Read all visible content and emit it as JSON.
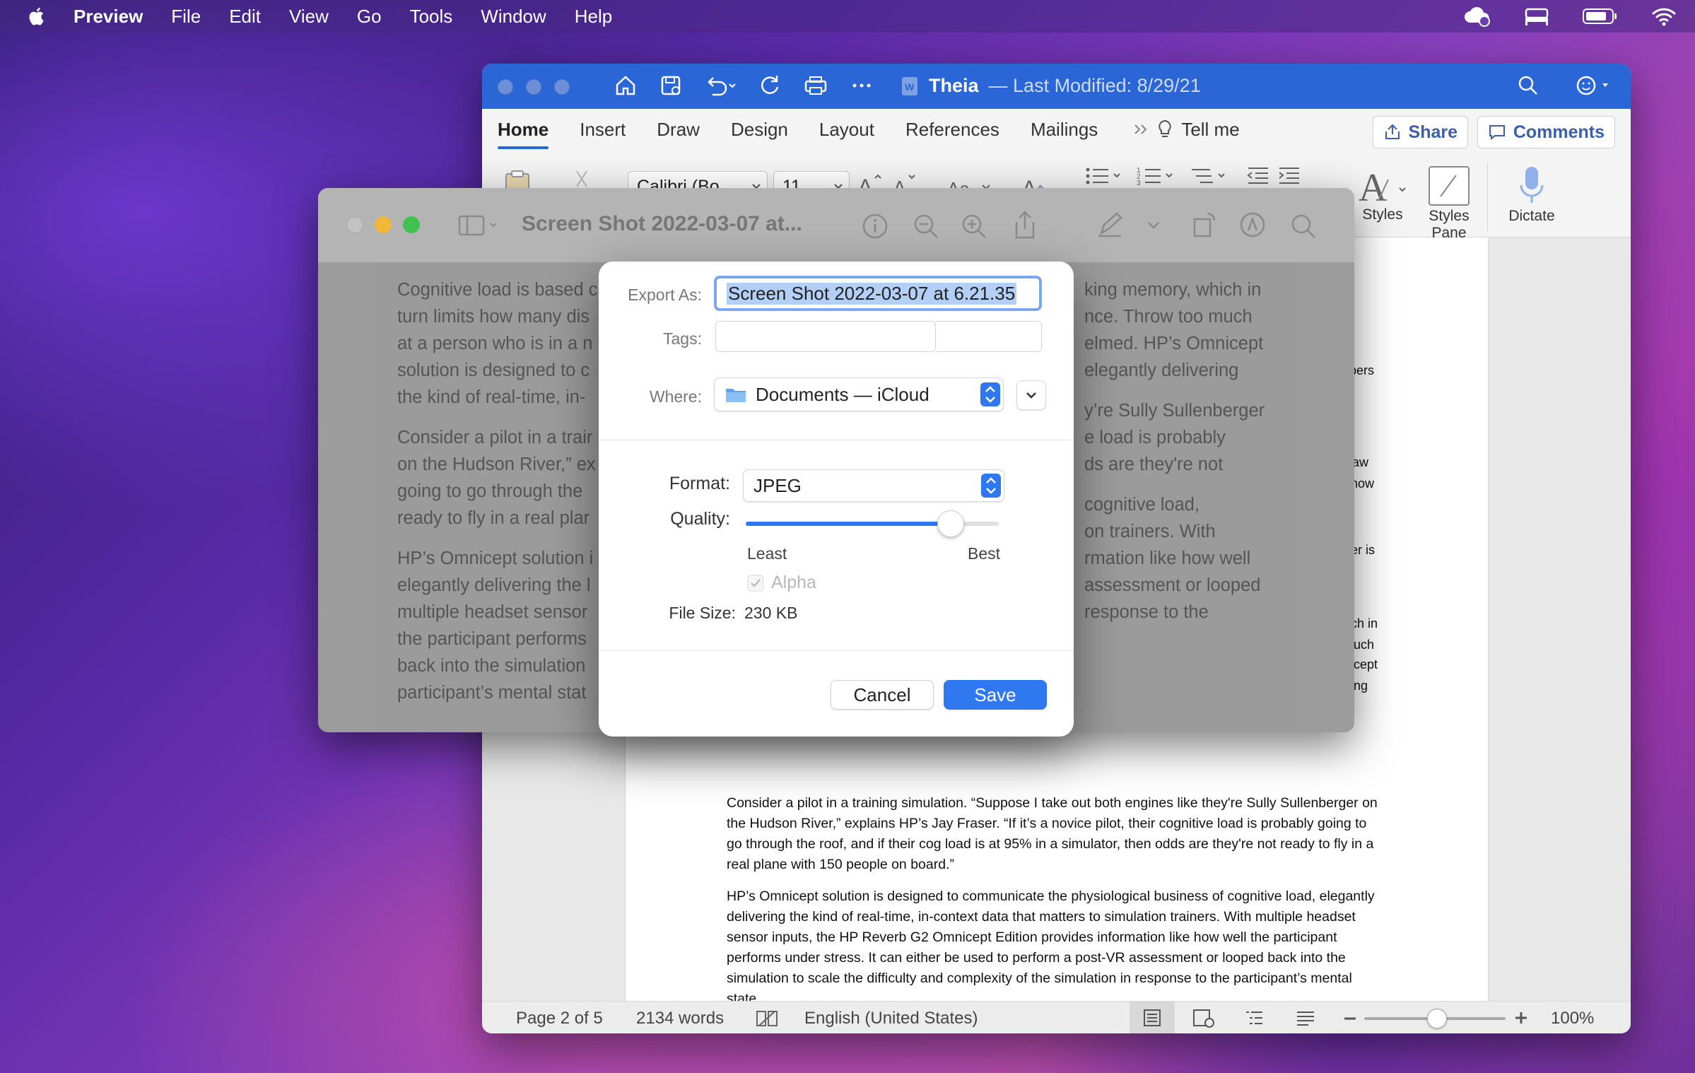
{
  "menubar": {
    "app_name": "Preview",
    "items": [
      "File",
      "Edit",
      "View",
      "Go",
      "Tools",
      "Window",
      "Help"
    ]
  },
  "word": {
    "doc_name": "Theia",
    "modified": "— Last Modified: 8/29/21",
    "tabs": [
      "Home",
      "Insert",
      "Draw",
      "Design",
      "Layout",
      "References",
      "Mailings"
    ],
    "tell_me": "Tell me",
    "share": "Share",
    "comments": "Comments",
    "font_name": "Calibri (Bo...",
    "font_size": "11",
    "styles": "Styles",
    "styles_pane_1": "Styles",
    "styles_pane_2": "Pane",
    "dictate": "Dictate",
    "edge_fragments": [
      "ppers",
      "aw",
      "now",
      "er is",
      "ch in",
      "uch",
      "icept",
      "ng"
    ],
    "para1": "Consider a pilot in a training simulation. “Suppose I take out both engines like they're Sully Sullenberger on the Hudson River,” explains HP’s Jay Fraser. “If it’s a novice pilot, their cognitive load is probably going to go through the roof, and if their cog load is at 95% in a simulator, then odds are they're not ready to fly in a real plane with 150 people on board.”",
    "para2": "HP’s Omnicept solution is designed to communicate the physiological business of cognitive load, elegantly delivering the kind of real-time, in-context data that matters to simulation trainers. With multiple headset sensor inputs, the HP Reverb G2 Omnicept Edition provides information like how well the participant performs under stress. It can either be used to perform a post-VR assessment or looped back into the simulation to scale the difficulty and complexity of the simulation in response to the participant’s mental state.",
    "status": {
      "page": "Page 2 of 5",
      "words": "2134 words",
      "language": "English (United States)",
      "zoom": "100%"
    }
  },
  "preview": {
    "title": "Screen Shot 2022-03-07 at...",
    "left_lines": [
      "Cognitive load is based c",
      "turn limits how many dis",
      "at a person who is in a n",
      "solution is designed to c",
      "the kind of real-time, in-",
      "Consider a pilot in a trair",
      "on the Hudson River,” ex",
      "going to go through the",
      "ready to fly in a real plar",
      "HP’s Omnicept solution i",
      "elegantly delivering the l",
      "multiple headset sensor",
      "the participant performs",
      "back into the simulation",
      "participant’s mental stat"
    ],
    "right_lines": [
      "king memory, which in",
      "nce. Throw too much",
      "elmed. HP’s Omnicept",
      "elegantly delivering",
      "y’re Sully Sullenberger",
      "e load is probably",
      "ds are they're not",
      "cognitive load,",
      "on trainers. With",
      "rmation like how well",
      "assessment or looped",
      "response to the"
    ]
  },
  "dialog": {
    "export_as_label": "Export As:",
    "export_as_value": "Screen Shot 2022-03-07 at 6.21.35",
    "tags_label": "Tags:",
    "tags_value": "",
    "where_label": "Where:",
    "where_value": "Documents — iCloud",
    "format_label": "Format:",
    "format_value": "JPEG",
    "quality_label": "Quality:",
    "quality_fraction": 0.81,
    "least": "Least",
    "best": "Best",
    "alpha": "Alpha",
    "alpha_checked": true,
    "file_size_label": "File Size:",
    "file_size_value": "230 KB",
    "cancel": "Cancel",
    "save": "Save"
  },
  "colors": {
    "word_blue": "#2b66d6",
    "accent": "#2f78f0"
  }
}
